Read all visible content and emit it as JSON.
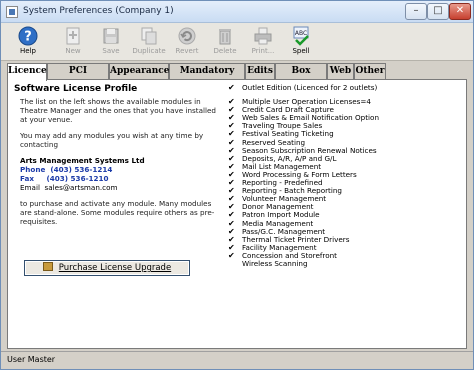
{
  "window": {
    "title": "System Preferences (Company 1)",
    "minimize": "–",
    "maximize": "□",
    "close": "✕"
  },
  "toolbar": [
    {
      "label": "Help",
      "icon": "help-icon",
      "enabled": true
    },
    {
      "label": "New",
      "icon": "new-icon",
      "enabled": false
    },
    {
      "label": "Save",
      "icon": "save-icon",
      "enabled": false
    },
    {
      "label": "Duplicate",
      "icon": "duplicate-icon",
      "enabled": false
    },
    {
      "label": "Revert",
      "icon": "revert-icon",
      "enabled": false
    },
    {
      "label": "Delete",
      "icon": "delete-icon",
      "enabled": false
    },
    {
      "label": "Print...",
      "icon": "print-icon",
      "enabled": false
    },
    {
      "label": "Spell",
      "icon": "spell-icon",
      "enabled": true
    }
  ],
  "tabs": [
    {
      "label": "Licence",
      "active": true
    },
    {
      "label": "PCI Security",
      "active": false
    },
    {
      "label": "Appearance",
      "active": false
    },
    {
      "label": "Mandatory Data",
      "active": false
    },
    {
      "label": "Edits",
      "active": false
    },
    {
      "label": "Box Office",
      "active": false
    },
    {
      "label": "Web",
      "active": false
    },
    {
      "label": "Other",
      "active": false
    }
  ],
  "licence": {
    "title": "Software License Profile",
    "para1": "The list on the left shows the available modules in Theatre Manager and the ones that you have installed at your venue.",
    "para2": "You may add any modules you wish at any time by contacting",
    "company": "Arts Management Systems Ltd",
    "phone": "Phone  (403) 536-1214",
    "fax": "Fax     (403) 536-1210",
    "email": "Email  sales@artsman.com",
    "para3": "to purchase and activate any module.  Many modules are stand-alone.  Some modules require others as pre-requisites.",
    "purchase_button": "Purchase License Upgrade"
  },
  "modules": [
    {
      "check": "✔",
      "label": "Outlet Edition (Licenced for 2 outlets)"
    },
    {
      "check": "✔",
      "label": "Multiple User Operation Licenses=4"
    },
    {
      "check": "✔",
      "label": "Credit Card Draft Capture"
    },
    {
      "check": "✔",
      "label": "Web Sales & Email Notification Option"
    },
    {
      "check": "✔",
      "label": "Traveling Troupe Sales"
    },
    {
      "check": "✔",
      "label": "Festival Seating Ticketing"
    },
    {
      "check": "✔",
      "label": "Reserved Seating"
    },
    {
      "check": "✔",
      "label": "Season Subscription Renewal Notices"
    },
    {
      "check": "✔",
      "label": "Deposits, A/R, A/P and G/L"
    },
    {
      "check": "✔",
      "label": "Mail List Management"
    },
    {
      "check": "✔",
      "label": "Word Processing & Form Letters"
    },
    {
      "check": "✔",
      "label": "Reporting - Predefined"
    },
    {
      "check": "✔",
      "label": "Reporting - Batch Reporting"
    },
    {
      "check": "✔",
      "label": "Volunteer Management"
    },
    {
      "check": "✔",
      "label": "Donor Management"
    },
    {
      "check": "✔",
      "label": "Patron Import Module"
    },
    {
      "check": "✔",
      "label": "Media Management"
    },
    {
      "check": "✔",
      "label": "Pass/G.C. Management"
    },
    {
      "check": "✔",
      "label": "Thermal Ticket Printer Drivers"
    },
    {
      "check": "✔",
      "label": "Facility Management"
    },
    {
      "check": "✔",
      "label": "Concession and Storefront"
    },
    {
      "check": "",
      "label": "Wireless Scanning"
    }
  ],
  "status": {
    "user": "User Master"
  }
}
